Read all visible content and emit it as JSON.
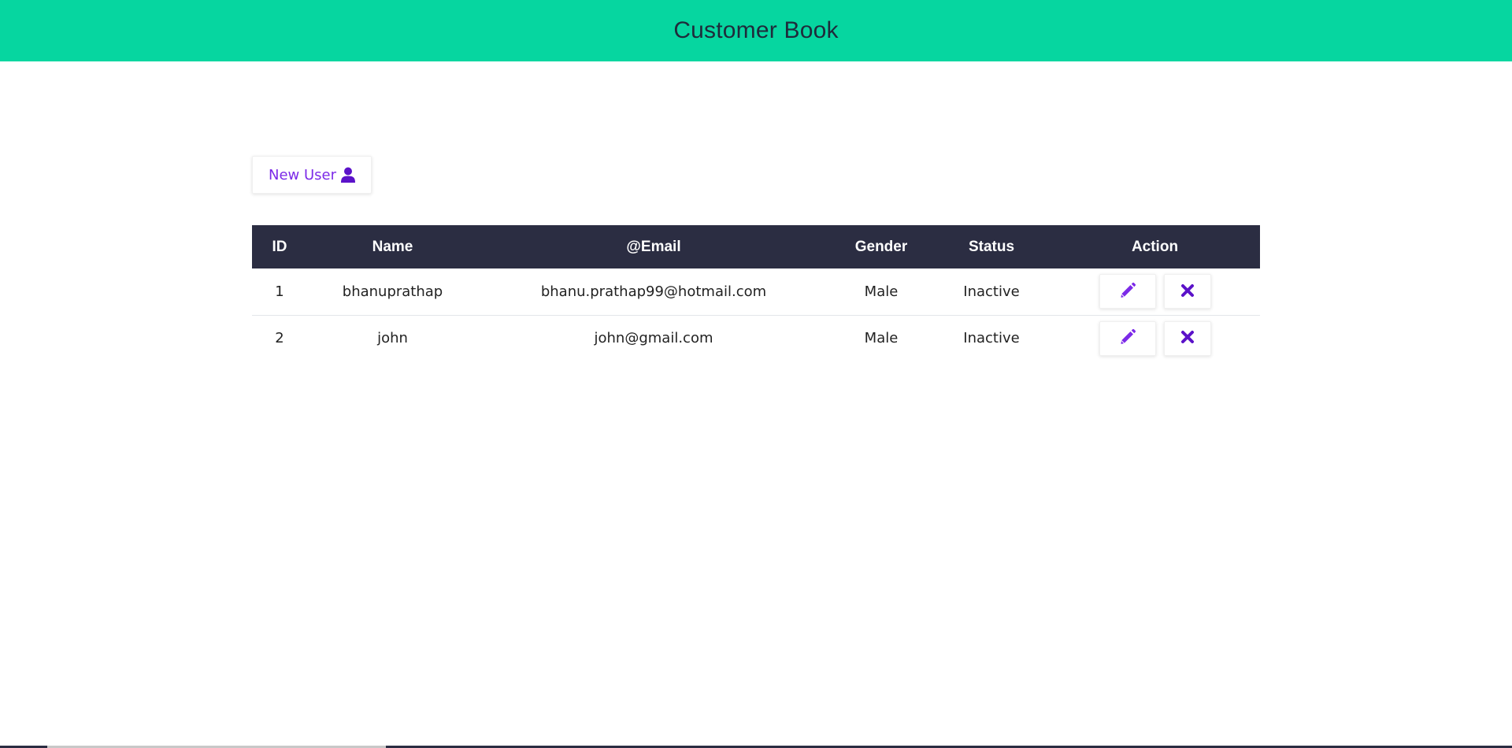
{
  "header": {
    "title": "Customer Book",
    "background": "#06d6a0"
  },
  "toolbar": {
    "new_user_label": "New User",
    "new_user_icon": "user-icon"
  },
  "table": {
    "columns": [
      "ID",
      "Name",
      "@Email",
      "Gender",
      "Status",
      "Action"
    ],
    "rows": [
      {
        "id": "1",
        "name": "bhanuprathap",
        "email": "bhanu.prathap99@hotmail.com",
        "gender": "Male",
        "status": "Inactive",
        "actions": [
          "edit-icon",
          "delete-icon"
        ]
      },
      {
        "id": "2",
        "name": "john",
        "email": "john@gmail.com",
        "gender": "Male",
        "status": "Inactive",
        "actions": [
          "edit-icon",
          "delete-icon"
        ]
      }
    ]
  },
  "colors": {
    "accent": "#7c2ae8",
    "table_header": "#2b2d42"
  }
}
